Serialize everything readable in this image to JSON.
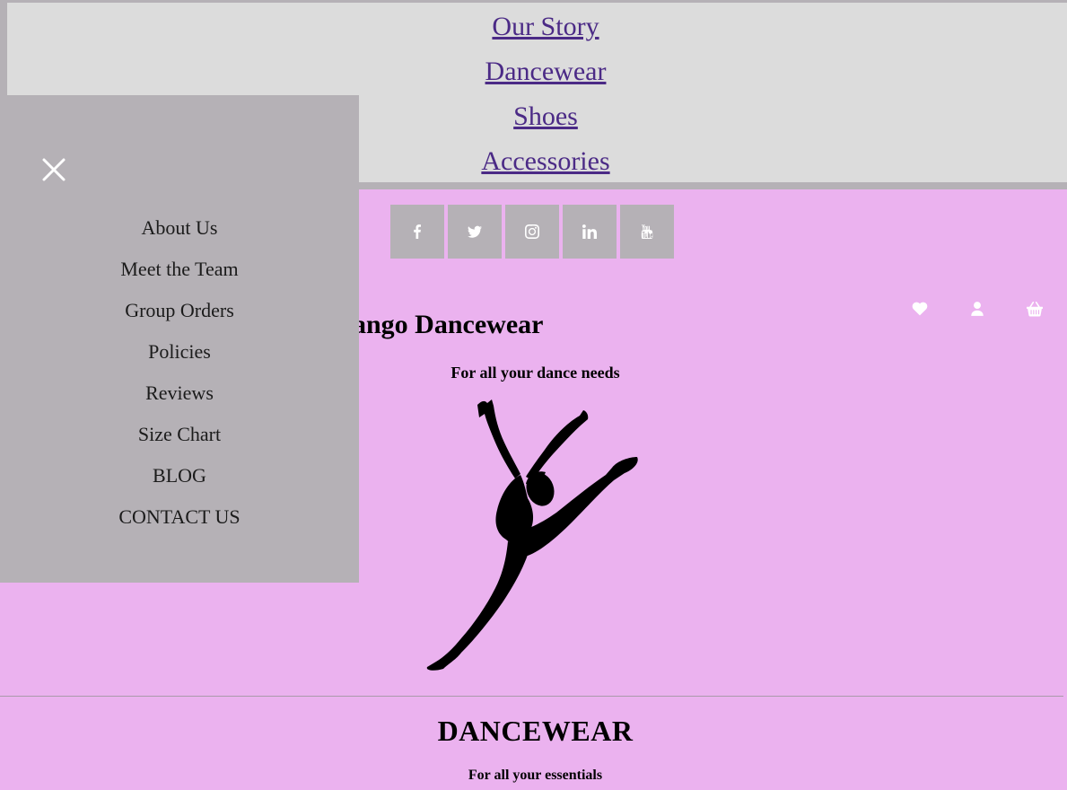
{
  "top_nav": {
    "links": [
      "Our Story",
      "Dancewear",
      "Shoes",
      "Accessories"
    ]
  },
  "social": {
    "icons": [
      "facebook-icon",
      "twitter-icon",
      "instagram-icon",
      "linkedin-icon",
      "youtube-icon"
    ]
  },
  "header_icons": [
    "heart-icon",
    "user-icon",
    "basket-icon"
  ],
  "brand": {
    "name": "ango Dancewear",
    "tagline": "For all your dance needs"
  },
  "section": {
    "title": "DANCEWEAR",
    "subtitle": "For all your essentials"
  },
  "drawer": {
    "items": [
      "About Us",
      "Meet the Team",
      "Group Orders",
      "Policies",
      "Reviews",
      "Size Chart",
      "BLOG",
      "CONTACT US"
    ]
  },
  "colors": {
    "page_background": "#ebb2ef",
    "nav_background": "#dcdcdc",
    "drawer_background": "#b5b1b6",
    "link_color": "#4b2a86"
  }
}
